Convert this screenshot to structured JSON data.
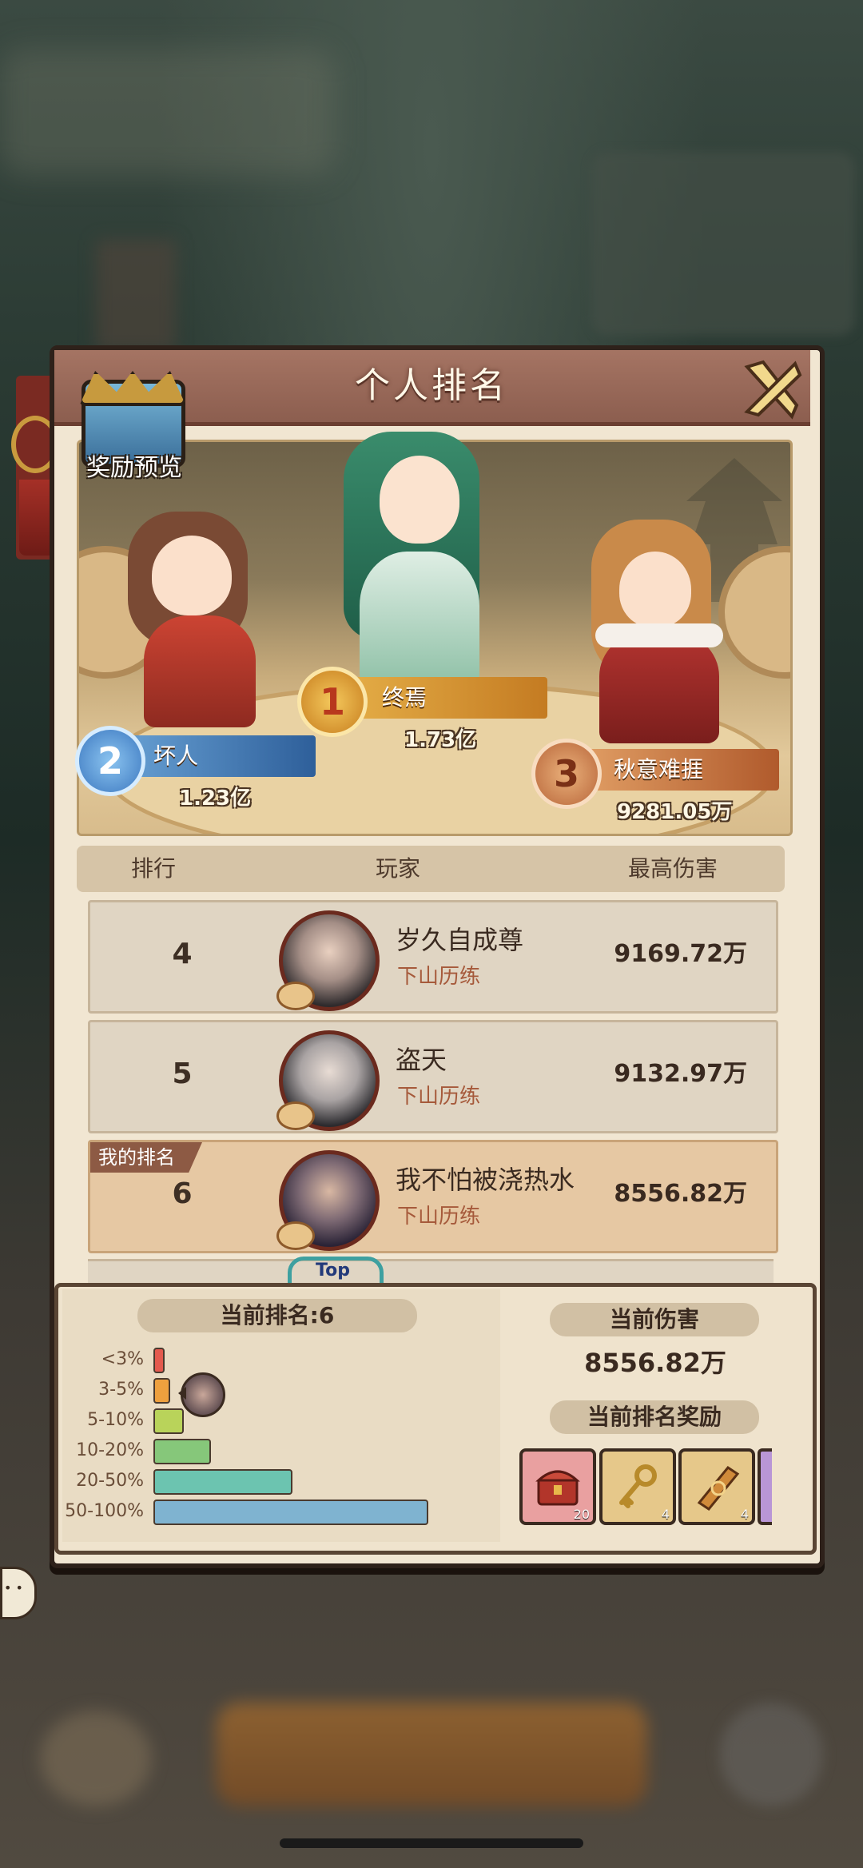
{
  "window": {
    "title": "个人排名",
    "reward_preview_label": "奖励预览"
  },
  "podium": [
    {
      "rank": "1",
      "name": "终焉",
      "score": "1.73亿"
    },
    {
      "rank": "2",
      "name": "坏人",
      "score": "1.23亿"
    },
    {
      "rank": "3",
      "name": "秋意难捱",
      "score": "9281.05万"
    }
  ],
  "table": {
    "headers": {
      "rank": "排行",
      "player": "玩家",
      "damage": "最高伤害"
    },
    "rows": [
      {
        "rank": "4",
        "name": "岁久自成尊",
        "guild": "下山历练",
        "damage": "9169.72万"
      },
      {
        "rank": "5",
        "name": "盗天",
        "guild": "下山历练",
        "damage": "9132.97万"
      },
      {
        "rank": "6",
        "name": "我不怕被浇热水",
        "guild": "下山历练",
        "damage": "8556.82万",
        "tag": "我的排名"
      }
    ],
    "peek_badge": "Top"
  },
  "summary": {
    "current_rank_label": "当前排名:6",
    "current_damage_title": "当前伤害",
    "current_damage_value": "8556.82万",
    "reward_title": "当前排名奖励",
    "distribution": [
      {
        "label": "<3%",
        "color": "#e45a4e",
        "fill": 0.03
      },
      {
        "label": "3-5%",
        "color": "#eea03e",
        "fill": 0.05
      },
      {
        "label": "5-10%",
        "color": "#b9d35a",
        "fill": 0.1
      },
      {
        "label": "10-20%",
        "color": "#86c77a",
        "fill": 0.2
      },
      {
        "label": "20-50%",
        "color": "#6cc4b0",
        "fill": 0.5
      },
      {
        "label": "50-100%",
        "color": "#7fb3d0",
        "fill": 1.0
      }
    ],
    "rewards": [
      {
        "icon": "treasure-chest-icon",
        "qty": "20",
        "bg": "#e9a0a0"
      },
      {
        "icon": "golden-key-icon",
        "qty": "4",
        "bg": "#e6c88a"
      },
      {
        "icon": "scroll-icon",
        "qty": "4",
        "bg": "#e6c88a"
      }
    ]
  }
}
